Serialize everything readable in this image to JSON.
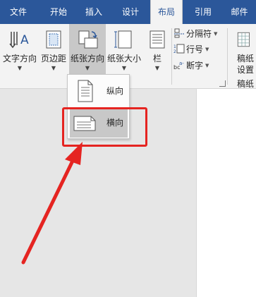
{
  "tabs": [
    {
      "label": "文件",
      "active": false
    },
    {
      "label": "开始",
      "active": false
    },
    {
      "label": "插入",
      "active": false
    },
    {
      "label": "设计",
      "active": false
    },
    {
      "label": "布局",
      "active": true
    },
    {
      "label": "引用",
      "active": false
    },
    {
      "label": "邮件",
      "active": false
    }
  ],
  "ribbon": {
    "text_direction": "文字方向",
    "margins": "页边距",
    "orientation": "纸张方向",
    "size": "纸张大小",
    "columns": "栏",
    "breaks": "分隔符",
    "line_numbers": "行号",
    "hyphenation": "断字",
    "draft_line1": "稿纸",
    "draft_line2": "设置",
    "draft_group": "稿纸",
    "hyphenation_icon_text": "a-",
    "hyphenation_icon_text2": "bc"
  },
  "orientation_menu": {
    "items": [
      {
        "label": "纵向",
        "selected": false
      },
      {
        "label": "横向",
        "selected": true
      }
    ]
  },
  "colors": {
    "tab_bar": "#2b579a",
    "highlight_box": "#e52421",
    "arrow": "#e52421"
  }
}
